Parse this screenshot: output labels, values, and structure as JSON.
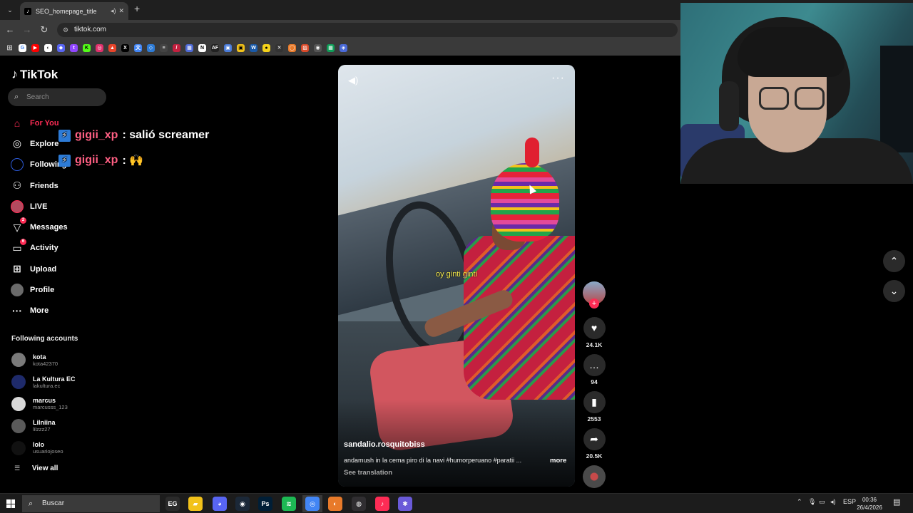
{
  "browser": {
    "tab_title": "SEO_homepage_title",
    "url": "tiktok.com",
    "new_tab": "+",
    "bookmarks": [
      {
        "icon": "google-icon",
        "color": "#ffffff",
        "glyph": "G",
        "fg": "#4285f4"
      },
      {
        "icon": "youtube-icon",
        "color": "#ff0000",
        "glyph": "▶",
        "fg": "#ffffff"
      },
      {
        "icon": "app-icon",
        "color": "#ffffff",
        "glyph": "◐",
        "fg": "#333333"
      },
      {
        "icon": "app-icon",
        "color": "#5865f2",
        "glyph": "◆",
        "fg": "#ffffff"
      },
      {
        "icon": "twitch-icon",
        "color": "#9146ff",
        "glyph": "t",
        "fg": "#ffffff"
      },
      {
        "icon": "kick-icon",
        "color": "#53fc18",
        "glyph": "K",
        "fg": "#000000"
      },
      {
        "icon": "instagram-icon",
        "color": "#e1306c",
        "glyph": "◎",
        "fg": "#ffffff"
      },
      {
        "icon": "app-icon",
        "color": "#e8442a",
        "glyph": "▲",
        "fg": "#ffffff"
      },
      {
        "icon": "x-icon",
        "color": "#000000",
        "glyph": "X",
        "fg": "#ffffff"
      },
      {
        "icon": "translate-icon",
        "color": "#4285f4",
        "glyph": "文",
        "fg": "#ffffff"
      },
      {
        "icon": "app-icon",
        "color": "#2d7bd6",
        "glyph": "◇",
        "fg": "#ffffff"
      },
      {
        "icon": "app-icon",
        "color": "#444444",
        "glyph": "≡",
        "fg": "#ffffff"
      },
      {
        "icon": "app-icon",
        "color": "#c4203f",
        "glyph": "/",
        "fg": "#ffffff"
      },
      {
        "icon": "app-icon",
        "color": "#4f6bd8",
        "glyph": "▦",
        "fg": "#ffffff"
      },
      {
        "icon": "notion-icon",
        "color": "#ffffff",
        "glyph": "N",
        "fg": "#000000"
      },
      {
        "icon": "app-icon",
        "color": "#222222",
        "glyph": "AF",
        "fg": "#ffffff"
      },
      {
        "icon": "app-icon",
        "color": "#4a7bd8",
        "glyph": "▣",
        "fg": "#ffffff"
      },
      {
        "icon": "app-icon",
        "color": "#f2c21a",
        "glyph": "▣",
        "fg": "#000000"
      },
      {
        "icon": "app-icon",
        "color": "#1a5aa8",
        "glyph": "W",
        "fg": "#ffffff"
      },
      {
        "icon": "app-icon",
        "color": "#f5d21a",
        "glyph": "●",
        "fg": "#000000"
      },
      {
        "icon": "app-icon",
        "color": "#333333",
        "glyph": "✕",
        "fg": "#ffffff"
      },
      {
        "icon": "app-icon",
        "color": "#e87a2a",
        "glyph": "◯",
        "fg": "#ffffff"
      },
      {
        "icon": "app-icon",
        "color": "#d84a2a",
        "glyph": "▨",
        "fg": "#ffffff"
      },
      {
        "icon": "app-icon",
        "color": "#555555",
        "glyph": "◉",
        "fg": "#ffffff"
      },
      {
        "icon": "sheets-icon",
        "color": "#0f9d58",
        "glyph": "▦",
        "fg": "#ffffff"
      },
      {
        "icon": "app-icon",
        "color": "#4a6ad8",
        "glyph": "◈",
        "fg": "#ffffff"
      }
    ]
  },
  "sidebar": {
    "logo": "TikTok",
    "search_placeholder": "Search",
    "nav": [
      {
        "label": "For You",
        "icon": "home-icon",
        "glyph": "⌂",
        "active": true
      },
      {
        "label": "Explore",
        "icon": "compass-icon",
        "glyph": "◎"
      },
      {
        "label": "Following",
        "icon": "following-icon",
        "glyph": "ring"
      },
      {
        "label": "Friends",
        "icon": "friends-icon",
        "glyph": "⚇"
      },
      {
        "label": "LIVE",
        "icon": "live-avatar-icon",
        "glyph": "live"
      },
      {
        "label": "Messages",
        "icon": "messages-icon",
        "glyph": "▽",
        "badge": "2"
      },
      {
        "label": "Activity",
        "icon": "activity-icon",
        "glyph": "▭",
        "badge": "6"
      },
      {
        "label": "Upload",
        "icon": "upload-icon",
        "glyph": "⊞"
      },
      {
        "label": "Profile",
        "icon": "profile-avatar-icon",
        "glyph": "profile"
      },
      {
        "label": "More",
        "icon": "more-icon",
        "glyph": "···"
      }
    ],
    "following_title": "Following accounts",
    "following": [
      {
        "name": "kota",
        "handle": "kota42370",
        "color": "#7a7a7a"
      },
      {
        "name": "La Kultura EC",
        "handle": "lakultura.ec",
        "color": "#1e2a6a"
      },
      {
        "name": "marcus",
        "handle": "marcusss_123",
        "color": "#d8d8d8"
      },
      {
        "name": "Lilniina",
        "handle": "lilzzz27",
        "color": "#5a5a5a"
      },
      {
        "name": "lolo",
        "handle": "usuariojoseo",
        "color": "#111111"
      }
    ],
    "view_all": "View all"
  },
  "chat": [
    {
      "user": "gigii_xp",
      "message": ": salió screamer"
    },
    {
      "user": "gigii_xp",
      "message": ": 🙌"
    }
  ],
  "video": {
    "caption": "oy ginti ginti",
    "author": "sandalio.rosquitobiss",
    "description": "andamush in la cema piro di la navi #humorperuano #paratii ...",
    "more": "more",
    "see_translation": "See translation"
  },
  "actions": {
    "likes": "24.1K",
    "comments": "94",
    "saves": "2553",
    "shares": "20.5K"
  },
  "taskbar": {
    "search_placeholder": "Buscar",
    "lang": "ESP",
    "time": "00:36",
    "date": "26/4/2026",
    "apps": [
      {
        "icon": "epic-games-icon",
        "color": "#2a2a2a",
        "glyph": "EG"
      },
      {
        "icon": "file-explorer-icon",
        "color": "#f2c21a",
        "glyph": "▰"
      },
      {
        "icon": "discord-icon",
        "color": "#5865f2",
        "glyph": "◕"
      },
      {
        "icon": "steam-icon",
        "color": "#1b2838",
        "glyph": "◉"
      },
      {
        "icon": "photoshop-icon",
        "color": "#001e36",
        "glyph": "Ps"
      },
      {
        "icon": "spotify-icon",
        "color": "#1db954",
        "glyph": "≋"
      },
      {
        "icon": "chrome-icon",
        "color": "#4285f4",
        "glyph": "◎"
      },
      {
        "icon": "app-icon",
        "color": "#e87a2a",
        "glyph": "◐"
      },
      {
        "icon": "obs-icon",
        "color": "#302e31",
        "glyph": "◍"
      },
      {
        "icon": "tiktok-icon",
        "color": "#fe2c55",
        "glyph": "♪"
      },
      {
        "icon": "app-icon",
        "color": "#6a5ad8",
        "glyph": "✱"
      }
    ]
  }
}
